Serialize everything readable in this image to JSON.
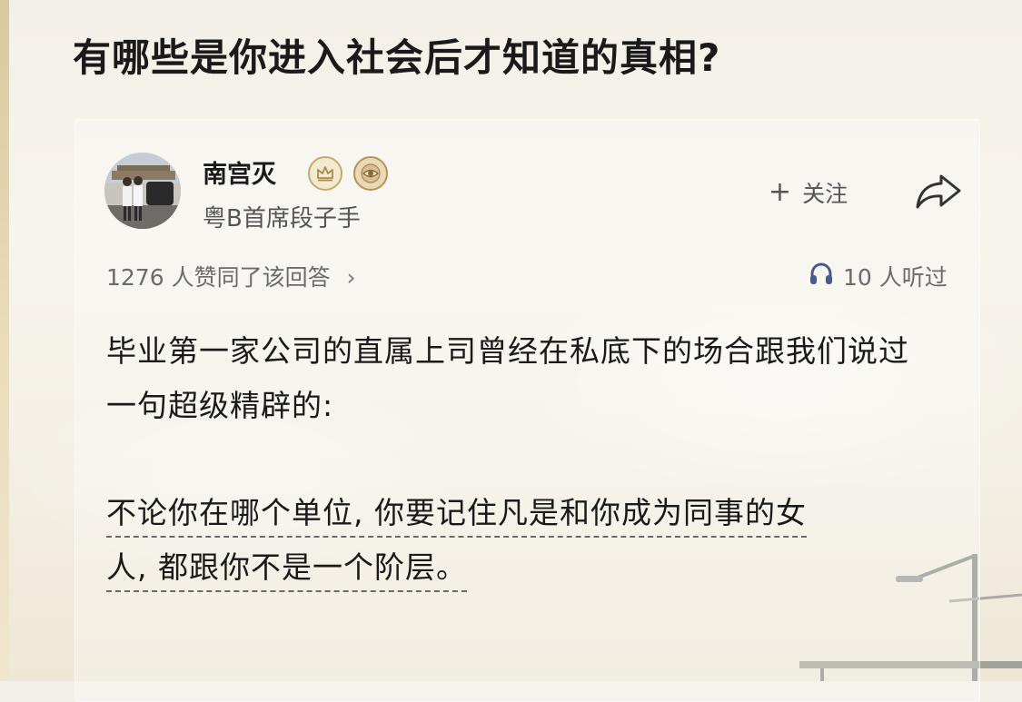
{
  "question": {
    "title": "有哪些是你进入社会后才知道的真相?"
  },
  "author": {
    "name": "南宫灭",
    "bio": "粤B首席段子手"
  },
  "actions": {
    "follow_label": "关注",
    "follow_plus": "+"
  },
  "stats": {
    "approve_text": "1276 人赞同了该回答",
    "approve_chevron": "›",
    "listen_text": "10 人听过"
  },
  "answer": {
    "paragraph_1": "毕业第一家公司的直属上司曾经在私底下的场合跟我们说过一句超级精辟的:",
    "paragraph_2_line_1": "不论你在哪个单位, 你要记住凡是和你成为同事的女",
    "paragraph_2_line_2": "人, 都跟你不是一个阶层。"
  },
  "icons": {
    "badge_1": "crown-badge-icon",
    "badge_2": "eye-badge-icon",
    "share": "share-arrow-icon",
    "listen": "headphone-icon"
  },
  "colors": {
    "badge_gold": "#c8a96b",
    "headphone_blue": "#4a5a8a",
    "text_primary": "#1a1a1a",
    "text_secondary": "#6b6b6b"
  }
}
